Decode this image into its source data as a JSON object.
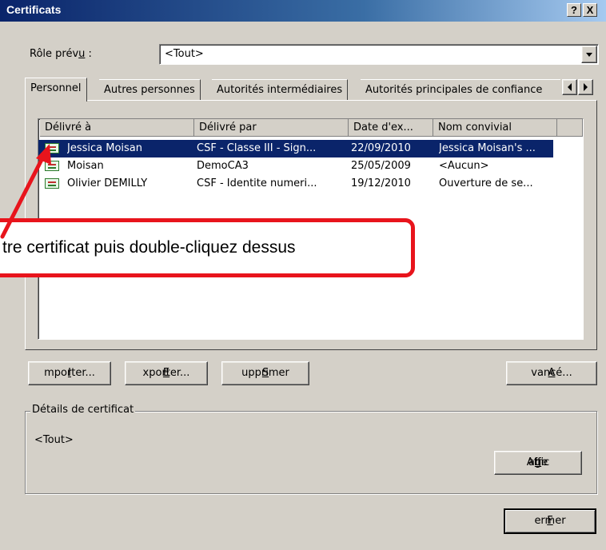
{
  "window": {
    "title": "Certificats",
    "help_button": "?",
    "close_button": "X"
  },
  "role": {
    "label_pre": "Rôle prév",
    "label_mnemonic": "u",
    "label_post": " :",
    "value": "<Tout>"
  },
  "tabs": [
    {
      "label": "Personnel"
    },
    {
      "label": "Autres personnes"
    },
    {
      "label": "Autorités intermédiaires"
    },
    {
      "label": "Autorités principales de confiance"
    }
  ],
  "table": {
    "columns": [
      "Délivré à",
      "Délivré par",
      "Date d'ex...",
      "Nom convivial"
    ],
    "rows": [
      {
        "issued_to": "Jessica Moisan",
        "issued_by": "CSF - Classe III - Sign...",
        "expires": "22/09/2010",
        "friendly": "Jessica Moisan's ...",
        "selected": true
      },
      {
        "issued_to": "Moisan",
        "issued_by": "DemoCA3",
        "expires": "25/05/2009",
        "friendly": "<Aucun>",
        "selected": false
      },
      {
        "issued_to": "Olivier DEMILLY",
        "issued_by": "CSF - Identite numeri...",
        "expires": "19/12/2010",
        "friendly": "Ouverture de se...",
        "selected": false
      }
    ]
  },
  "buttons": {
    "import": {
      "mn": "I",
      "rest": "mporter..."
    },
    "export": {
      "mn": "E",
      "rest": "xporter..."
    },
    "delete": {
      "mn": "S",
      "rest": "upprimer"
    },
    "advanced": {
      "mn": "A",
      "rest": "vancé..."
    },
    "view": {
      "pre": "Affic",
      "mn": "h",
      "post": "age"
    },
    "close": {
      "mn": "F",
      "rest": "ermer"
    }
  },
  "details": {
    "legend": "Détails de certificat",
    "value": "<Tout>"
  },
  "callout": {
    "text": "tre certificat puis double-cliquez dessus",
    "color": "#e8141c"
  }
}
